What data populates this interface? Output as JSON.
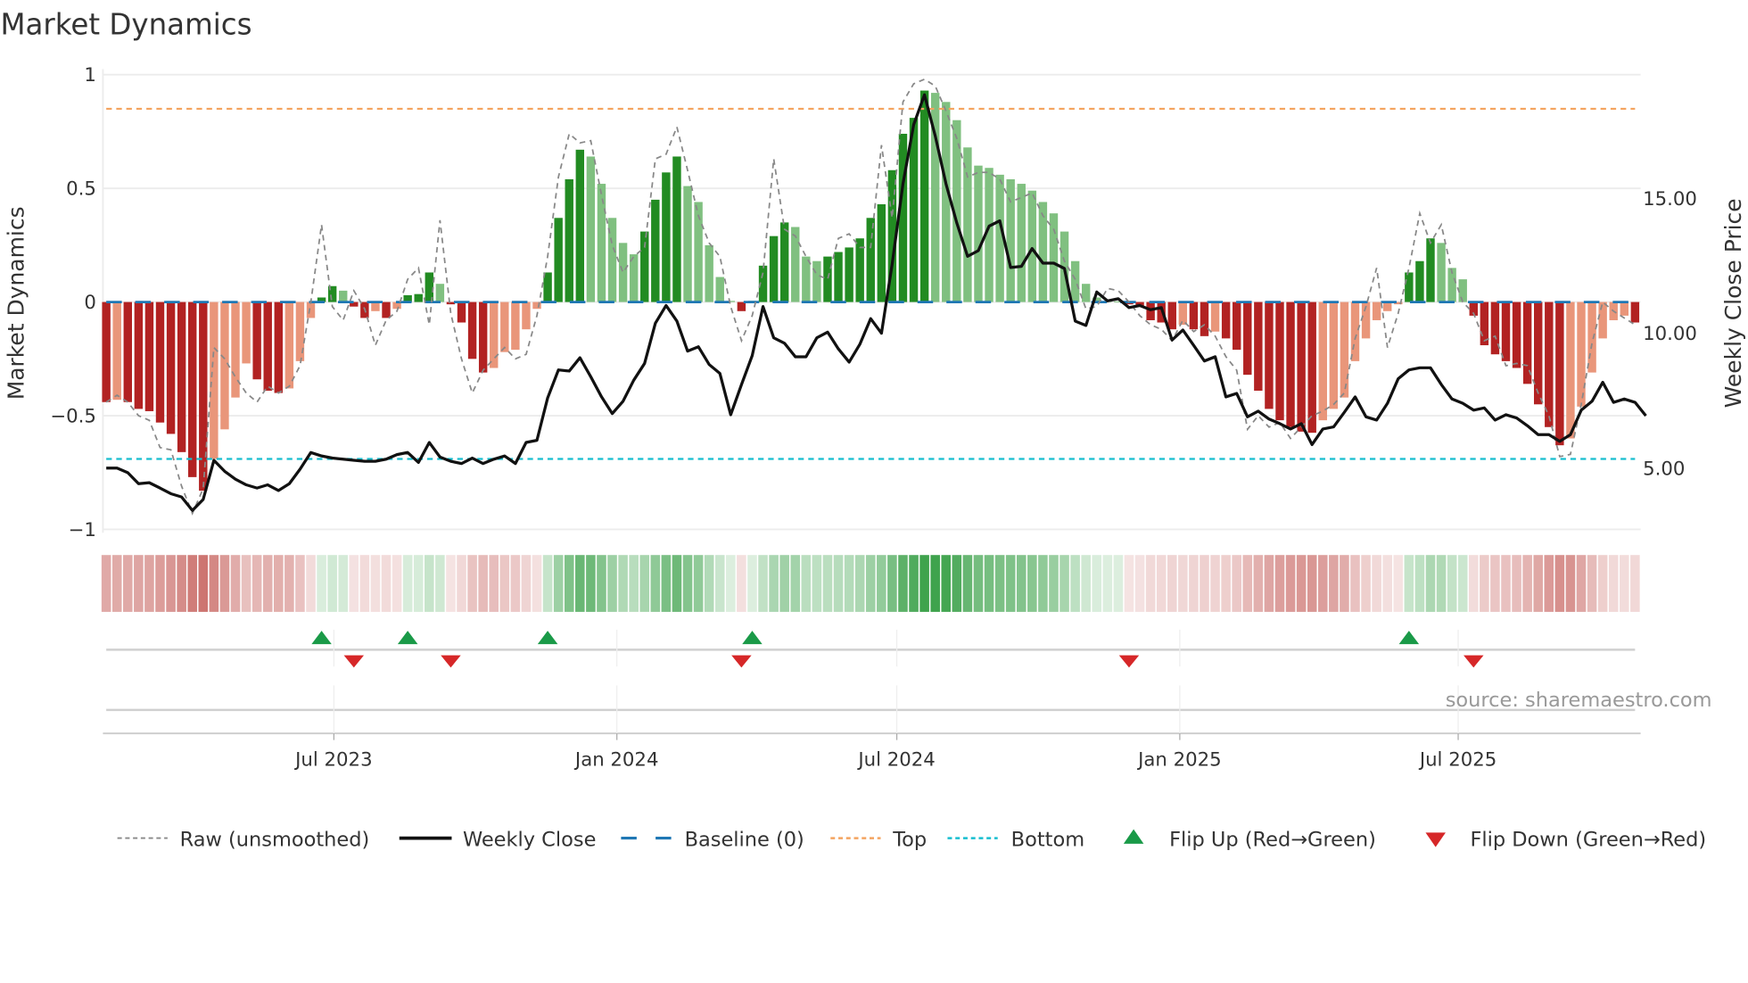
{
  "chart_data": {
    "type": "bar",
    "title": "Market Dynamics",
    "ylabel": "Market Dynamics",
    "y2label": "Weekly Close Price",
    "ylim": [
      -1,
      1
    ],
    "y2lim": [
      2.9,
      19.9
    ],
    "yticks": [
      {
        "v": 1,
        "label": "1"
      },
      {
        "v": 0.5,
        "label": "0.5"
      },
      {
        "v": 0,
        "label": "0"
      },
      {
        "v": -0.5,
        "label": "−0.5"
      },
      {
        "v": -1,
        "label": "−1"
      }
    ],
    "y2ticks": [
      {
        "v": 15,
        "label": "15.00"
      },
      {
        "v": 10,
        "label": "10.00"
      },
      {
        "v": 5,
        "label": "5.00"
      }
    ],
    "xticks": [
      {
        "date": "2023-07-01",
        "label": "Jul 2023"
      },
      {
        "date": "2024-01-01",
        "label": "Jan 2024"
      },
      {
        "date": "2024-07-01",
        "label": "Jul 2024"
      },
      {
        "date": "2025-01-01",
        "label": "Jan 2025"
      },
      {
        "date": "2025-07-01",
        "label": "Jul 2025"
      }
    ],
    "start_date": "2023-02-03",
    "frequency_days": 7,
    "top_threshold": 0.85,
    "bottom_threshold": -0.69,
    "baseline": 0,
    "smoothed": [
      -0.44,
      -0.43,
      -0.44,
      -0.47,
      -0.48,
      -0.53,
      -0.58,
      -0.66,
      -0.77,
      -0.83,
      -0.69,
      -0.56,
      -0.42,
      -0.27,
      -0.34,
      -0.39,
      -0.4,
      -0.38,
      -0.26,
      -0.07,
      0.02,
      0.07,
      0.05,
      -0.02,
      -0.07,
      -0.04,
      -0.07,
      -0.03,
      0.03,
      0.035,
      0.13,
      0.08,
      -0.01,
      -0.09,
      -0.25,
      -0.31,
      -0.29,
      -0.22,
      -0.21,
      -0.12,
      -0.03,
      0.13,
      0.37,
      0.54,
      0.67,
      0.64,
      0.52,
      0.37,
      0.26,
      0.21,
      0.31,
      0.45,
      0.57,
      0.64,
      0.51,
      0.44,
      0.25,
      0.11,
      0.005,
      -0.04,
      0.005,
      0.16,
      0.29,
      0.35,
      0.33,
      0.2,
      0.18,
      0.2,
      0.22,
      0.24,
      0.28,
      0.37,
      0.43,
      0.58,
      0.74,
      0.81,
      0.93,
      0.92,
      0.88,
      0.8,
      0.68,
      0.6,
      0.59,
      0.56,
      0.54,
      0.52,
      0.49,
      0.44,
      0.39,
      0.31,
      0.18,
      0.08,
      0.02,
      0.005,
      0.003,
      -0.01,
      -0.02,
      -0.08,
      -0.09,
      -0.12,
      -0.1,
      -0.12,
      -0.15,
      -0.13,
      -0.16,
      -0.21,
      -0.32,
      -0.39,
      -0.47,
      -0.52,
      -0.55,
      -0.57,
      -0.575,
      -0.52,
      -0.47,
      -0.42,
      -0.26,
      -0.16,
      -0.08,
      -0.04,
      -0.01,
      0.13,
      0.18,
      0.28,
      0.26,
      0.15,
      0.1,
      -0.06,
      -0.19,
      -0.23,
      -0.26,
      -0.29,
      -0.36,
      -0.45,
      -0.55,
      -0.63,
      -0.6,
      -0.46,
      -0.31,
      -0.16,
      -0.08,
      -0.06,
      -0.09
    ],
    "raw": [
      -0.44,
      -0.41,
      -0.44,
      -0.5,
      -0.52,
      -0.64,
      -0.65,
      -0.81,
      -0.93,
      -0.82,
      -0.2,
      -0.25,
      -0.33,
      -0.4,
      -0.44,
      -0.37,
      -0.4,
      -0.37,
      -0.28,
      0.0,
      0.34,
      -0.02,
      -0.08,
      0.05,
      -0.03,
      -0.19,
      -0.08,
      -0.04,
      0.1,
      0.15,
      -0.1,
      0.36,
      -0.05,
      -0.25,
      -0.4,
      -0.3,
      -0.25,
      -0.2,
      -0.25,
      -0.23,
      -0.06,
      0.2,
      0.55,
      0.74,
      0.7,
      0.71,
      0.47,
      0.25,
      0.13,
      0.2,
      0.24,
      0.63,
      0.65,
      0.77,
      0.58,
      0.38,
      0.26,
      0.2,
      -0.02,
      -0.17,
      -0.06,
      0.13,
      0.63,
      0.32,
      0.29,
      0.2,
      0.12,
      0.1,
      0.28,
      0.3,
      0.24,
      0.24,
      0.69,
      0.37,
      0.88,
      0.96,
      0.98,
      0.95,
      0.84,
      0.72,
      0.55,
      0.57,
      0.57,
      0.54,
      0.44,
      0.46,
      0.48,
      0.38,
      0.32,
      0.18,
      0.1,
      -0.03,
      -0.02,
      0.06,
      0.05,
      0.0,
      -0.06,
      -0.1,
      -0.12,
      -0.17,
      -0.08,
      -0.13,
      -0.1,
      -0.15,
      -0.24,
      -0.3,
      -0.56,
      -0.5,
      -0.55,
      -0.53,
      -0.6,
      -0.55,
      -0.5,
      -0.48,
      -0.45,
      -0.4,
      -0.16,
      -0.02,
      0.15,
      -0.2,
      -0.05,
      0.15,
      0.39,
      0.26,
      0.34,
      0.13,
      0.0,
      -0.05,
      -0.17,
      -0.15,
      -0.28,
      -0.27,
      -0.28,
      -0.4,
      -0.5,
      -0.68,
      -0.67,
      -0.45,
      -0.18,
      0.0,
      -0.04,
      -0.07,
      -0.1
    ],
    "weekly_close": [
      5.0,
      5.0,
      4.83,
      4.42,
      4.46,
      4.26,
      4.05,
      3.93,
      3.43,
      3.84,
      5.29,
      4.88,
      4.59,
      4.38,
      4.26,
      4.38,
      4.17,
      4.42,
      4.96,
      5.58,
      5.45,
      5.37,
      5.33,
      5.29,
      5.25,
      5.25,
      5.33,
      5.5,
      5.58,
      5.21,
      5.95,
      5.41,
      5.25,
      5.17,
      5.37,
      5.17,
      5.33,
      5.45,
      5.17,
      5.95,
      6.03,
      7.6,
      8.64,
      8.6,
      9.09,
      8.39,
      7.64,
      7.02,
      7.48,
      8.26,
      8.88,
      10.37,
      11.03,
      10.45,
      9.34,
      9.5,
      8.84,
      8.51,
      6.98,
      8.1,
      9.17,
      10.99,
      9.83,
      9.63,
      9.13,
      9.13,
      9.83,
      10.04,
      9.42,
      8.93,
      9.59,
      10.54,
      10.0,
      12.56,
      15.54,
      17.73,
      18.84,
      17.31,
      15.54,
      14.09,
      12.85,
      13.06,
      13.97,
      14.17,
      12.44,
      12.48,
      13.14,
      12.6,
      12.6,
      12.4,
      10.45,
      10.29,
      11.53,
      11.2,
      11.28,
      10.95,
      11.03,
      10.87,
      10.95,
      9.75,
      10.12,
      9.55,
      8.97,
      9.13,
      7.64,
      7.77,
      6.9,
      7.11,
      6.82,
      6.65,
      6.45,
      6.65,
      5.87,
      6.45,
      6.53,
      7.07,
      7.64,
      6.9,
      6.78,
      7.4,
      8.31,
      8.64,
      8.72,
      8.72,
      8.1,
      7.56,
      7.4,
      7.15,
      7.23,
      6.78,
      6.98,
      6.86,
      6.57,
      6.24,
      6.24,
      5.99,
      6.24,
      7.15,
      7.48,
      8.18,
      7.44,
      7.56,
      7.44,
      6.94
    ],
    "flip_up_weeks": [
      20,
      28,
      41,
      60,
      121
    ],
    "flip_down_weeks": [
      23,
      32,
      59,
      95,
      127
    ],
    "legend": [
      {
        "key": "raw",
        "label": "Raw (unsmoothed)"
      },
      {
        "key": "close",
        "label": "Weekly Close"
      },
      {
        "key": "baseline",
        "label": "Baseline (0)"
      },
      {
        "key": "top",
        "label": "Top"
      },
      {
        "key": "bottom",
        "label": "Bottom"
      },
      {
        "key": "flipup",
        "label": "Flip Up (Red→Green)"
      },
      {
        "key": "flipdown",
        "label": "Flip Down (Green→Red)"
      }
    ],
    "legend_placement": "bottom",
    "source": "source: sharemaestro.com",
    "colors": {
      "pos_rising": "#228b22",
      "pos_falling": "#80c080",
      "neg_falling": "#b22222",
      "neg_rising": "#e9967a",
      "raw": "#888888",
      "close": "#111111",
      "baseline": "#1f77b4",
      "top": "#f4a460",
      "bottom": "#17becf",
      "flip_up": "#1a9a48",
      "flip_down": "#d62728"
    }
  }
}
